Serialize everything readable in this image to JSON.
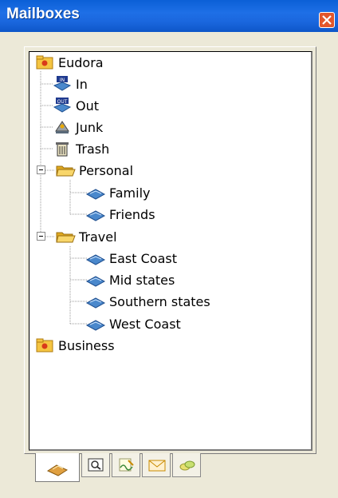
{
  "window": {
    "title": "Mailboxes"
  },
  "tree": {
    "root": "Eudora",
    "system": [
      "In",
      "Out",
      "Junk",
      "Trash"
    ],
    "personal": {
      "label": "Personal",
      "children": [
        "Family",
        "Friends"
      ]
    },
    "travel": {
      "label": "Travel",
      "children": [
        "East Coast",
        "Mid states",
        "Southern states",
        "West Coast"
      ]
    },
    "business": "Business"
  },
  "tabs": [
    {
      "icon": "mailboxes-icon",
      "active": true
    },
    {
      "icon": "find-icon",
      "active": false
    },
    {
      "icon": "signature-icon",
      "active": false
    },
    {
      "icon": "stationery-icon",
      "active": false
    },
    {
      "icon": "personalities-icon",
      "active": false
    }
  ],
  "colors": {
    "title_bar": "#1a66dd",
    "close": "#e2562c",
    "folder": "#f5c542",
    "mailbox": "#4a88cc"
  }
}
